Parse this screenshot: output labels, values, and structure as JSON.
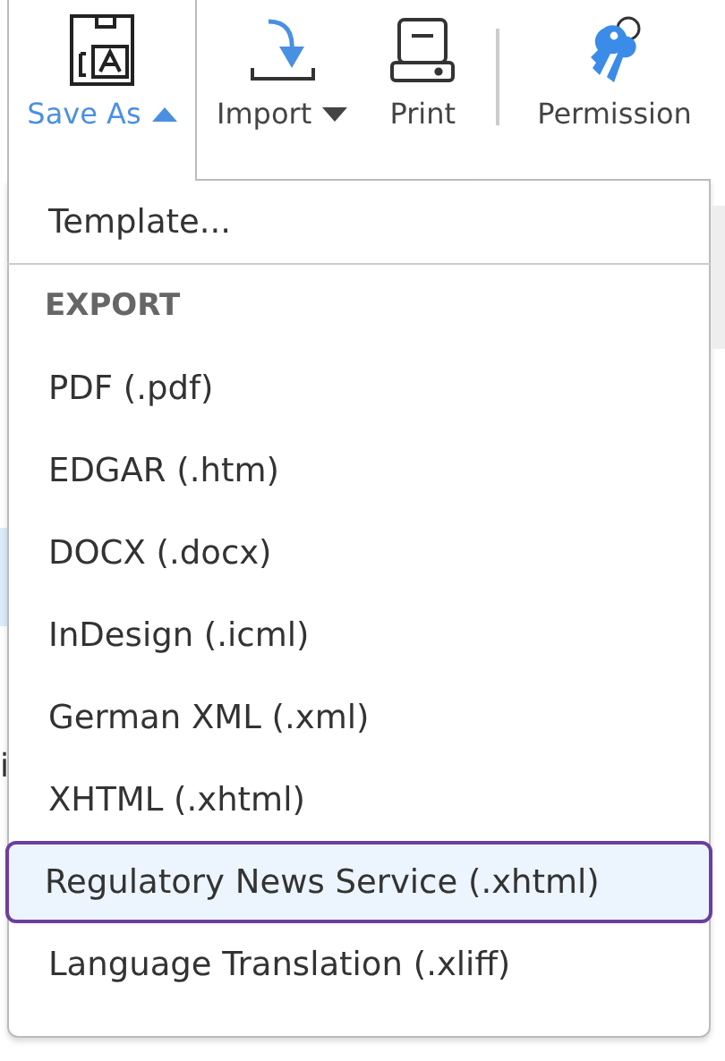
{
  "toolbar": {
    "buttons": [
      {
        "label": "Save As",
        "kind": "save",
        "has_caret": true,
        "open": true
      },
      {
        "label": "Import",
        "kind": "import",
        "has_caret": true,
        "open": false
      },
      {
        "label": "Print",
        "kind": "print",
        "open": false
      },
      {
        "kind": "separator"
      },
      {
        "label": "Permission",
        "kind": "permission",
        "open": false
      }
    ]
  },
  "menu": {
    "items": [
      {
        "kind": "item",
        "label": "Template...",
        "selected": false
      },
      {
        "kind": "divider"
      },
      {
        "kind": "header",
        "label": "EXPORT"
      },
      {
        "kind": "item",
        "label": "PDF (.pdf)",
        "selected": false
      },
      {
        "kind": "item",
        "label": "EDGAR (.htm)",
        "selected": false
      },
      {
        "kind": "item",
        "label": "DOCX (.docx)",
        "selected": false
      },
      {
        "kind": "item",
        "label": "InDesign (.icml)",
        "selected": false
      },
      {
        "kind": "item",
        "label": "German XML (.xml)",
        "selected": false
      },
      {
        "kind": "item",
        "label": "XHTML (.xhtml)",
        "selected": false
      },
      {
        "kind": "item",
        "label": "Regulatory News Service (.xhtml)",
        "selected": true
      },
      {
        "kind": "item",
        "label": "Language Translation (.xliff)",
        "selected": false
      }
    ]
  },
  "background": {
    "left_fragment": "i"
  }
}
